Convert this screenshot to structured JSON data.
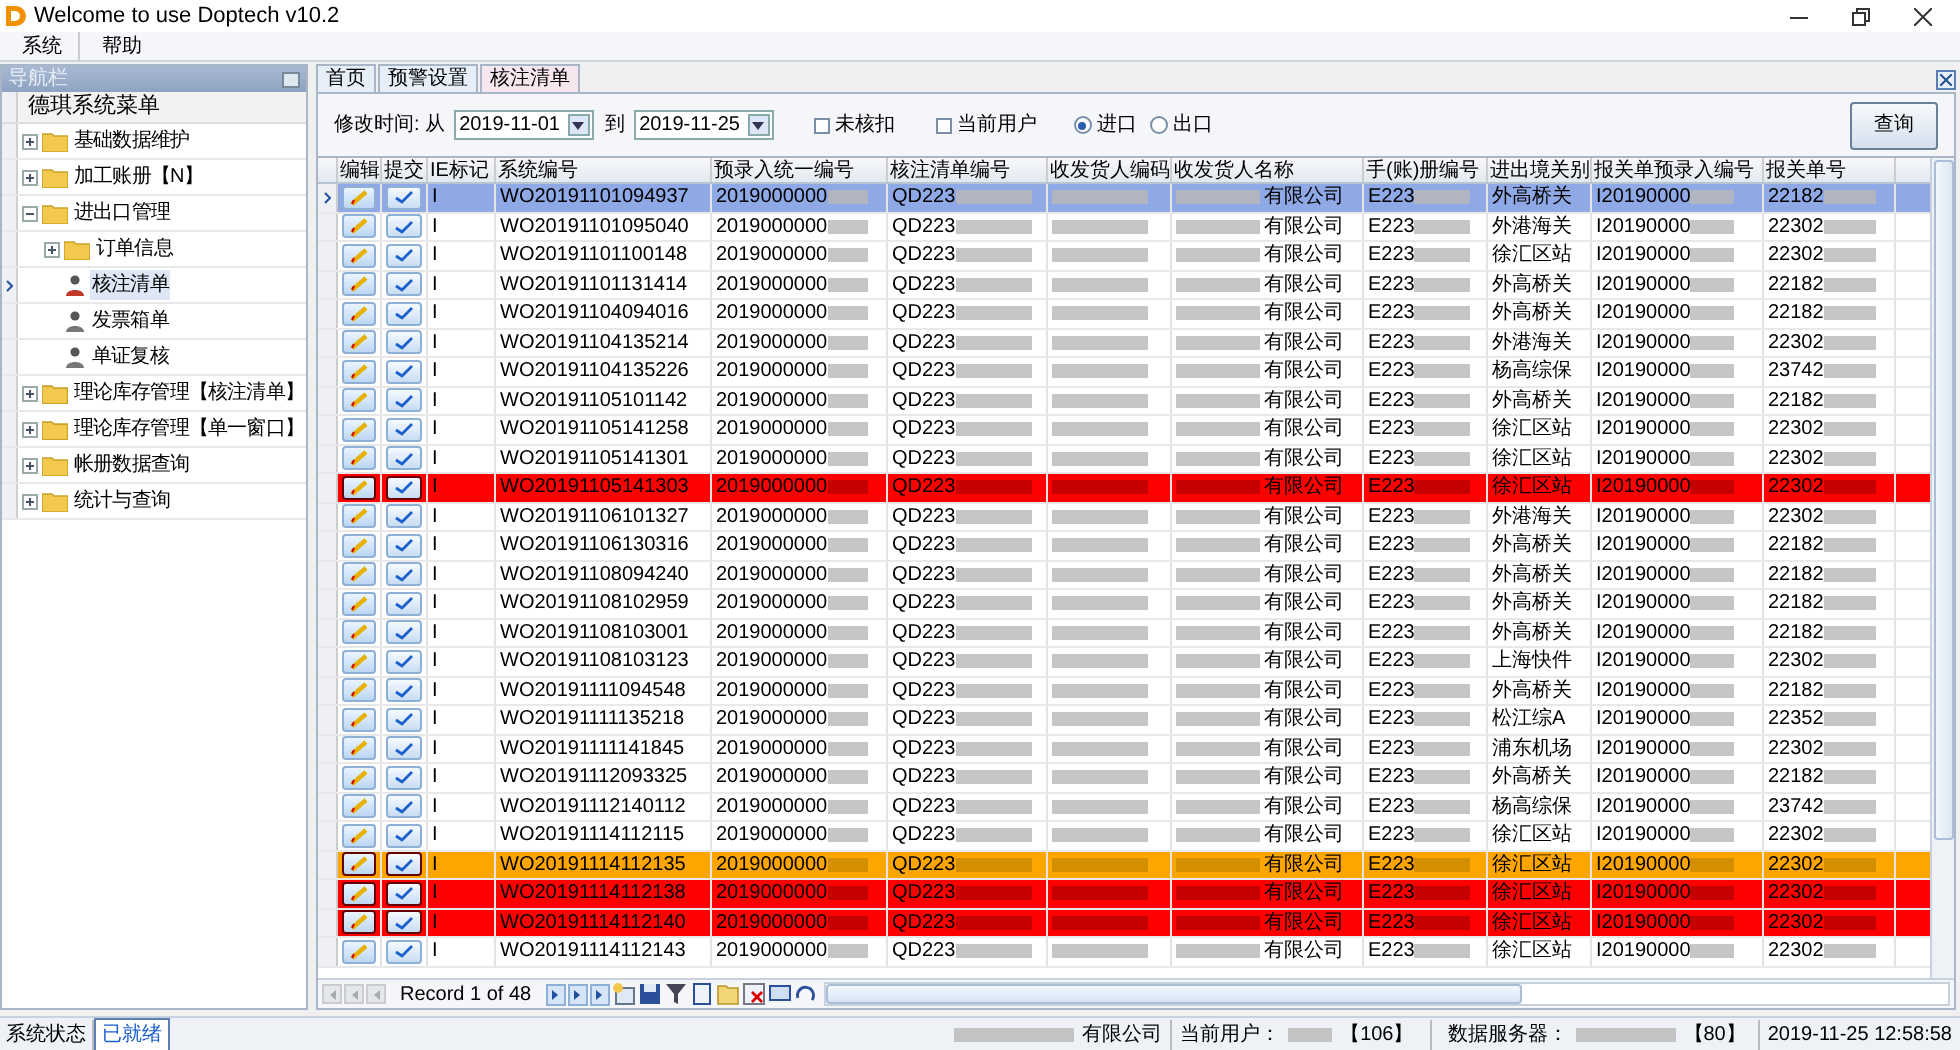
{
  "window": {
    "title": "Welcome to use Doptech v10.2"
  },
  "menu": [
    "系统",
    "帮助"
  ],
  "sidebar": {
    "title": "导航栏",
    "root": "德琪系统菜单",
    "items": [
      {
        "label": "基础数据维护",
        "kind": "folder",
        "expanded": false,
        "selected": false
      },
      {
        "label": "加工账册【N】",
        "kind": "folder",
        "expanded": false,
        "selected": false
      },
      {
        "label": "进出口管理",
        "kind": "folder",
        "expanded": true,
        "selected": false,
        "children": [
          {
            "label": "订单信息",
            "kind": "folder",
            "expanded": false,
            "selected": false
          },
          {
            "label": "核注清单",
            "kind": "doc",
            "selected": true
          },
          {
            "label": "发票箱单",
            "kind": "doc",
            "selected": false
          },
          {
            "label": "单证复核",
            "kind": "doc",
            "selected": false
          }
        ]
      },
      {
        "label": "理论库存管理【核注清单】",
        "kind": "folder",
        "expanded": false,
        "selected": false
      },
      {
        "label": "理论库存管理【单一窗口】",
        "kind": "folder",
        "expanded": false,
        "selected": false
      },
      {
        "label": "帐册数据查询",
        "kind": "folder",
        "expanded": false,
        "selected": false
      },
      {
        "label": "统计与查询",
        "kind": "folder",
        "expanded": false,
        "selected": false
      }
    ]
  },
  "tabs": [
    {
      "label": "首页",
      "selected": false
    },
    {
      "label": "预警设置",
      "selected": false
    },
    {
      "label": "核注清单",
      "selected": true
    }
  ],
  "filter": {
    "label_from": "修改时间: 从",
    "date_from": "2019-11-01",
    "label_to": "到",
    "date_to": "2019-11-25",
    "checks": [
      {
        "label": "未核扣",
        "checked": false
      },
      {
        "label": "当前用户",
        "checked": false
      }
    ],
    "radios": [
      {
        "label": "进口",
        "selected": true
      },
      {
        "label": "出口",
        "selected": false
      }
    ],
    "search_button": "查询"
  },
  "table": {
    "columns": [
      "编辑",
      "提交",
      "IE标记",
      "系统编号",
      "预录入统一编号",
      "核注清单编号",
      "收发货人编码",
      "收发货人名称",
      "手(账)册编号",
      "进出境关别",
      "报关单预录入编号",
      "报关单号"
    ],
    "rows": [
      {
        "ie": "I",
        "sys_no": "WO20191101094937",
        "pre_no": "2019000000",
        "list_no": "QD223",
        "owner": "有限公司",
        "manual": "E223",
        "customs": "外高桥关",
        "decl_pre": "I20190000",
        "decl_no": "22182",
        "selected": true,
        "kind": "normal"
      },
      {
        "ie": "I",
        "sys_no": "WO20191101095040",
        "pre_no": "2019000000",
        "list_no": "QD223",
        "owner": "有限公司",
        "manual": "E223",
        "customs": "外港海关",
        "decl_pre": "I20190000",
        "decl_no": "22302",
        "selected": false,
        "kind": "normal"
      },
      {
        "ie": "I",
        "sys_no": "WO20191101100148",
        "pre_no": "2019000000",
        "list_no": "QD223",
        "owner": "有限公司",
        "manual": "E223",
        "customs": "徐汇区站",
        "decl_pre": "I20190000",
        "decl_no": "22302",
        "selected": false,
        "kind": "normal"
      },
      {
        "ie": "I",
        "sys_no": "WO20191101131414",
        "pre_no": "2019000000",
        "list_no": "QD223",
        "owner": "有限公司",
        "manual": "E223",
        "customs": "外高桥关",
        "decl_pre": "I20190000",
        "decl_no": "22182",
        "selected": false,
        "kind": "normal"
      },
      {
        "ie": "I",
        "sys_no": "WO20191104094016",
        "pre_no": "2019000000",
        "list_no": "QD223",
        "owner": "有限公司",
        "manual": "E223",
        "customs": "外高桥关",
        "decl_pre": "I20190000",
        "decl_no": "22182",
        "selected": false,
        "kind": "normal"
      },
      {
        "ie": "I",
        "sys_no": "WO20191104135214",
        "pre_no": "2019000000",
        "list_no": "QD223",
        "owner": "有限公司",
        "manual": "E223",
        "customs": "外港海关",
        "decl_pre": "I20190000",
        "decl_no": "22302",
        "selected": false,
        "kind": "normal"
      },
      {
        "ie": "I",
        "sys_no": "WO20191104135226",
        "pre_no": "2019000000",
        "list_no": "QD223",
        "owner": "有限公司",
        "manual": "E223",
        "customs": "杨高综保",
        "decl_pre": "I20190000",
        "decl_no": "23742",
        "selected": false,
        "kind": "normal"
      },
      {
        "ie": "I",
        "sys_no": "WO20191105101142",
        "pre_no": "2019000000",
        "list_no": "QD223",
        "owner": "有限公司",
        "manual": "E223",
        "customs": "外高桥关",
        "decl_pre": "I20190000",
        "decl_no": "22182",
        "selected": false,
        "kind": "normal"
      },
      {
        "ie": "I",
        "sys_no": "WO20191105141258",
        "pre_no": "2019000000",
        "list_no": "QD223",
        "owner": "有限公司",
        "manual": "E223",
        "customs": "徐汇区站",
        "decl_pre": "I20190000",
        "decl_no": "22302",
        "selected": false,
        "kind": "normal"
      },
      {
        "ie": "I",
        "sys_no": "WO20191105141301",
        "pre_no": "2019000000",
        "list_no": "QD223",
        "owner": "有限公司",
        "manual": "E223",
        "customs": "徐汇区站",
        "decl_pre": "I20190000",
        "decl_no": "22302",
        "selected": false,
        "kind": "normal"
      },
      {
        "ie": "I",
        "sys_no": "WO20191105141303",
        "pre_no": "2019000000",
        "list_no": "QD223",
        "owner": "有限公司",
        "manual": "E223",
        "customs": "徐汇区站",
        "decl_pre": "I20190000",
        "decl_no": "22302",
        "selected": false,
        "kind": "error"
      },
      {
        "ie": "I",
        "sys_no": "WO20191106101327",
        "pre_no": "2019000000",
        "list_no": "QD223",
        "owner": "有限公司",
        "manual": "E223",
        "customs": "外港海关",
        "decl_pre": "I20190000",
        "decl_no": "22302",
        "selected": false,
        "kind": "normal"
      },
      {
        "ie": "I",
        "sys_no": "WO20191106130316",
        "pre_no": "2019000000",
        "list_no": "QD223",
        "owner": "有限公司",
        "manual": "E223",
        "customs": "外高桥关",
        "decl_pre": "I20190000",
        "decl_no": "22182",
        "selected": false,
        "kind": "normal"
      },
      {
        "ie": "I",
        "sys_no": "WO20191108094240",
        "pre_no": "2019000000",
        "list_no": "QD223",
        "owner": "有限公司",
        "manual": "E223",
        "customs": "外高桥关",
        "decl_pre": "I20190000",
        "decl_no": "22182",
        "selected": false,
        "kind": "normal"
      },
      {
        "ie": "I",
        "sys_no": "WO20191108102959",
        "pre_no": "2019000000",
        "list_no": "QD223",
        "owner": "有限公司",
        "manual": "E223",
        "customs": "外高桥关",
        "decl_pre": "I20190000",
        "decl_no": "22182",
        "selected": false,
        "kind": "normal"
      },
      {
        "ie": "I",
        "sys_no": "WO20191108103001",
        "pre_no": "2019000000",
        "list_no": "QD223",
        "owner": "有限公司",
        "manual": "E223",
        "customs": "外高桥关",
        "decl_pre": "I20190000",
        "decl_no": "22182",
        "selected": false,
        "kind": "normal"
      },
      {
        "ie": "I",
        "sys_no": "WO20191108103123",
        "pre_no": "2019000000",
        "list_no": "QD223",
        "owner": "有限公司",
        "manual": "E223",
        "customs": "上海快件",
        "decl_pre": "I20190000",
        "decl_no": "22302",
        "selected": false,
        "kind": "normal"
      },
      {
        "ie": "I",
        "sys_no": "WO20191111094548",
        "pre_no": "2019000000",
        "list_no": "QD223",
        "owner": "有限公司",
        "manual": "E223",
        "customs": "外高桥关",
        "decl_pre": "I20190000",
        "decl_no": "22182",
        "selected": false,
        "kind": "normal"
      },
      {
        "ie": "I",
        "sys_no": "WO20191111135218",
        "pre_no": "2019000000",
        "list_no": "QD223",
        "owner": "有限公司",
        "manual": "E223",
        "customs": "松江综A",
        "decl_pre": "I20190000",
        "decl_no": "22352",
        "selected": false,
        "kind": "normal"
      },
      {
        "ie": "I",
        "sys_no": "WO20191111141845",
        "pre_no": "2019000000",
        "list_no": "QD223",
        "owner": "有限公司",
        "manual": "E223",
        "customs": "浦东机场",
        "decl_pre": "I20190000",
        "decl_no": "22302",
        "selected": false,
        "kind": "normal"
      },
      {
        "ie": "I",
        "sys_no": "WO20191112093325",
        "pre_no": "2019000000",
        "list_no": "QD223",
        "owner": "有限公司",
        "manual": "E223",
        "customs": "外高桥关",
        "decl_pre": "I20190000",
        "decl_no": "22182",
        "selected": false,
        "kind": "normal"
      },
      {
        "ie": "I",
        "sys_no": "WO20191112140112",
        "pre_no": "2019000000",
        "list_no": "QD223",
        "owner": "有限公司",
        "manual": "E223",
        "customs": "杨高综保",
        "decl_pre": "I20190000",
        "decl_no": "23742",
        "selected": false,
        "kind": "normal"
      },
      {
        "ie": "I",
        "sys_no": "WO20191114112115",
        "pre_no": "2019000000",
        "list_no": "QD223",
        "owner": "有限公司",
        "manual": "E223",
        "customs": "徐汇区站",
        "decl_pre": "I20190000",
        "decl_no": "22302",
        "selected": false,
        "kind": "normal"
      },
      {
        "ie": "I",
        "sys_no": "WO20191114112135",
        "pre_no": "2019000000",
        "list_no": "QD223",
        "owner": "有限公司",
        "manual": "E223",
        "customs": "徐汇区站",
        "decl_pre": "I20190000",
        "decl_no": "22302",
        "selected": false,
        "kind": "warning"
      },
      {
        "ie": "I",
        "sys_no": "WO20191114112138",
        "pre_no": "2019000000",
        "list_no": "QD223",
        "owner": "有限公司",
        "manual": "E223",
        "customs": "徐汇区站",
        "decl_pre": "I20190000",
        "decl_no": "22302",
        "selected": false,
        "kind": "error"
      },
      {
        "ie": "I",
        "sys_no": "WO20191114112140",
        "pre_no": "2019000000",
        "list_no": "QD223",
        "owner": "有限公司",
        "manual": "E223",
        "customs": "徐汇区站",
        "decl_pre": "I20190000",
        "decl_no": "22302",
        "selected": false,
        "kind": "error"
      },
      {
        "ie": "I",
        "sys_no": "WO20191114112143",
        "pre_no": "2019000000",
        "list_no": "QD223",
        "owner": "有限公司",
        "manual": "E223",
        "customs": "徐汇区站",
        "decl_pre": "I20190000",
        "decl_no": "22302",
        "selected": false,
        "kind": "normal"
      }
    ]
  },
  "pager": {
    "record": "Record 1 of 48"
  },
  "status_bar": {
    "label": "系统状态",
    "state": "已就绪",
    "company": "有限公司",
    "user_label": "当前用户：",
    "user_id": "【106】",
    "server_label": "数据服务器：",
    "server_port": "【80】",
    "time": "2019-11-25 12:58:58"
  }
}
